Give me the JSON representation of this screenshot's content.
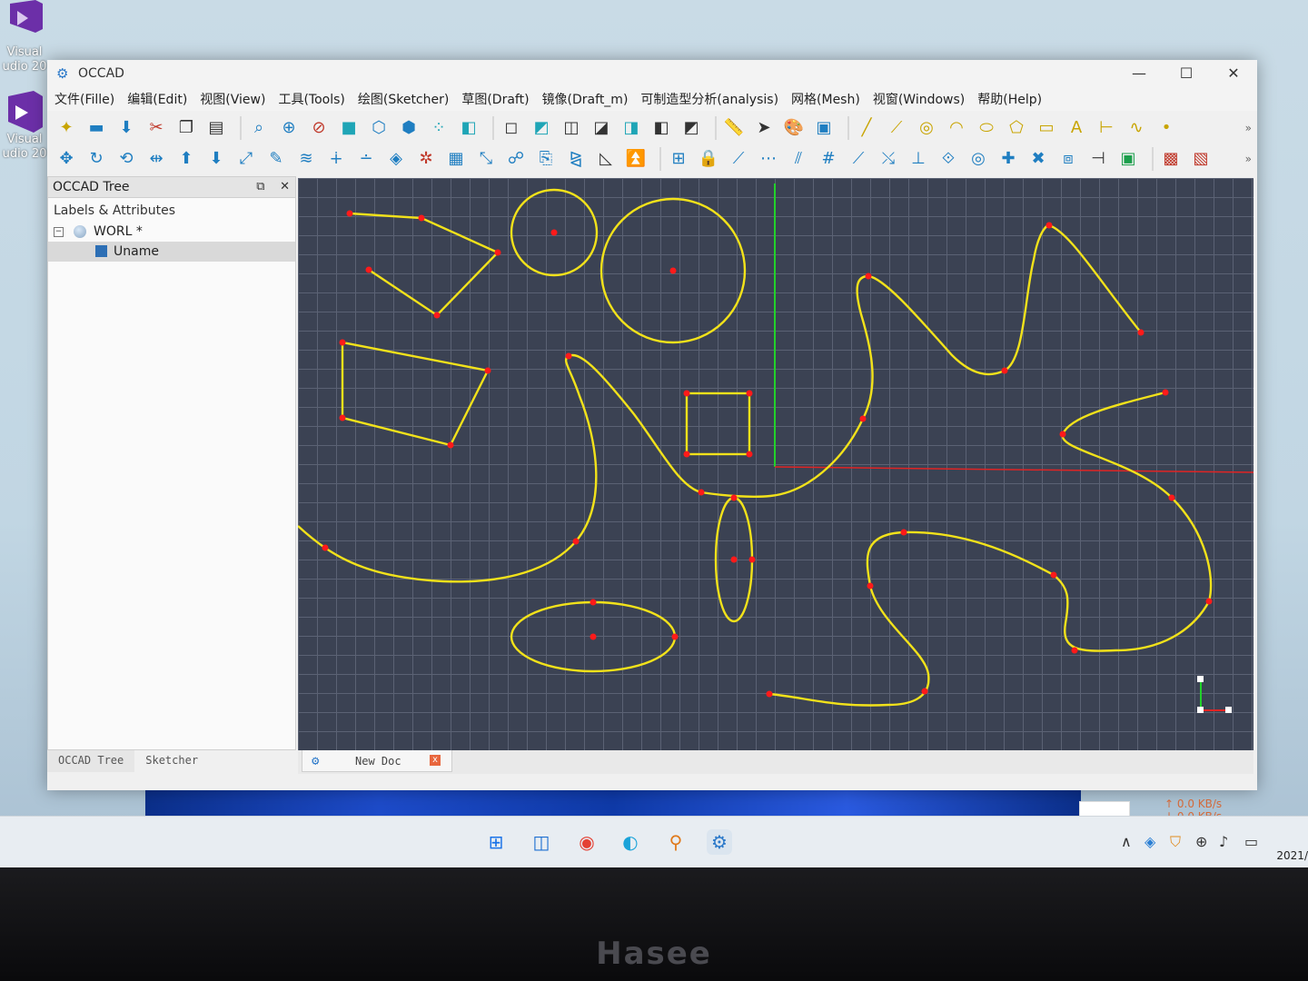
{
  "desktop": {
    "icons": [
      {
        "label": "Visual",
        "label2": "udio 20"
      },
      {
        "label": "Visual",
        "label2": "udio 20"
      }
    ]
  },
  "window": {
    "title": "OCCAD",
    "minimize": "—",
    "maximize": "☐",
    "close": "✕"
  },
  "menu": [
    "文件(Fille)",
    "编辑(Edit)",
    "视图(View)",
    "工具(Tools)",
    "绘图(Sketcher)",
    "草图(Draft)",
    "镜像(Draft_m)",
    "可制造型分析(analysis)",
    "网格(Mesh)",
    "视窗(Windows)",
    "帮助(Help)"
  ],
  "dock": {
    "title": "OCCAD Tree",
    "float_btn": "⧉",
    "close_btn": "✕",
    "header": "Labels & Attributes",
    "root_expander": "−",
    "root_label": "WORL *",
    "child_label": "Uname"
  },
  "bottom_tabs": [
    "OCCAD Tree",
    "Sketcher"
  ],
  "document_tab": {
    "name": "New Doc",
    "close": "x"
  },
  "toolbar_overflow": "»",
  "status": {
    "net_up": "↑ 0.0 KB/s",
    "net_down": "↓ 0.0 KB/s",
    "clock": "2021/"
  },
  "brand": "Hasee",
  "colors": {
    "curve": "#f2e21a",
    "point": "#ff1a1a",
    "viewport": "#3b4253",
    "axis_x": "#e02424",
    "axis_y": "#22d12a"
  }
}
